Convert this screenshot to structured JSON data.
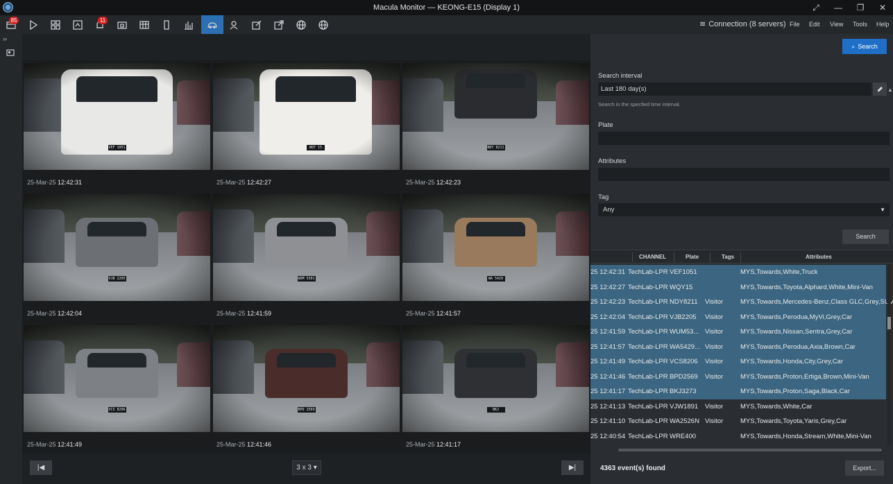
{
  "window": {
    "title": "Macula Monitor — KEONG-E15 (Display 1)",
    "controls": [
      "⤢",
      "—",
      "❐",
      "✕"
    ]
  },
  "toolbar": {
    "badge_events": "85",
    "badge_alarms": "11",
    "connection_label": "Connection (8 servers)",
    "menu": [
      "File",
      "Edit",
      "View",
      "Tools",
      "Help"
    ]
  },
  "grid": {
    "cells": [
      {
        "date": "25-Mar-25",
        "time": "12:42:31",
        "plate": "VEF 1051"
      },
      {
        "date": "25-Mar-25",
        "time": "12:42:27",
        "plate": "WQY 15"
      },
      {
        "date": "25-Mar-25",
        "time": "12:42:23",
        "plate": "NDY 8211"
      },
      {
        "date": "25-Mar-25",
        "time": "12:42:04",
        "plate": "VJB 2205"
      },
      {
        "date": "25-Mar-25",
        "time": "12:41:59",
        "plate": "WUM 5301"
      },
      {
        "date": "25-Mar-25",
        "time": "12:41:57",
        "plate": "WA 5429"
      },
      {
        "date": "25-Mar-25",
        "time": "12:41:49",
        "plate": "VCS 8206"
      },
      {
        "date": "25-Mar-25",
        "time": "12:41:46",
        "plate": "BPD 2569"
      },
      {
        "date": "25-Mar-25",
        "time": "12:41:17",
        "plate": "BKJ"
      }
    ],
    "layout_label": "3 x 3"
  },
  "panel": {
    "search_top_label": "Search",
    "interval_label": "Search interval",
    "interval_value": "Last 180 day(s)",
    "interval_hint": "Search in the specfied time interval.",
    "plate_label": "Plate",
    "plate_value": "",
    "attributes_label": "Attributes",
    "attributes_value": "",
    "tag_label": "Tag",
    "tag_value": "Any",
    "search_label": "Search"
  },
  "table": {
    "headers": [
      "CHANNEL",
      "Plate",
      "Tags",
      "Attributes"
    ],
    "rows": [
      {
        "time": "25 12:42:31",
        "channel": "TechLab-LPR",
        "plate": "VEF1051",
        "tag": "",
        "attrs": "MYS,Towards,White,Truck",
        "selected": true
      },
      {
        "time": "25 12:42:27",
        "channel": "TechLab-LPR",
        "plate": "WQY15",
        "tag": "",
        "attrs": "MYS,Towards,Toyota,Alphard,White,Mini-Van",
        "selected": true
      },
      {
        "time": "25 12:42:23",
        "channel": "TechLab-LPR",
        "plate": "NDY8211",
        "tag": "Visitor",
        "attrs": "MYS,Towards,Mercedes-Benz,Class GLC,Grey,SUV",
        "selected": true
      },
      {
        "time": "25 12:42:04",
        "channel": "TechLab-LPR",
        "plate": "VJB2205",
        "tag": "Visitor",
        "attrs": "MYS,Towards,Perodua,MyVi,Grey,Car",
        "selected": true
      },
      {
        "time": "25 12:41:59",
        "channel": "TechLab-LPR",
        "plate": "WUM53...",
        "tag": "Visitor",
        "attrs": "MYS,Towards,Nissan,Sentra,Grey,Car",
        "selected": true
      },
      {
        "time": "25 12:41:57",
        "channel": "TechLab-LPR",
        "plate": "WA5429...",
        "tag": "Visitor",
        "attrs": "MYS,Towards,Perodua,Axia,Brown,Car",
        "selected": true
      },
      {
        "time": "25 12:41:49",
        "channel": "TechLab-LPR",
        "plate": "VCS8206",
        "tag": "Visitor",
        "attrs": "MYS,Towards,Honda,City,Grey,Car",
        "selected": true
      },
      {
        "time": "25 12:41:46",
        "channel": "TechLab-LPR",
        "plate": "BPD2569",
        "tag": "Visitor",
        "attrs": "MYS,Towards,Proton,Ertiga,Brown,Mini-Van",
        "selected": true
      },
      {
        "time": "25 12:41:17",
        "channel": "TechLab-LPR",
        "plate": "BKJ3273",
        "tag": "",
        "attrs": "MYS,Towards,Proton,Saga,Black,Car",
        "selected": true
      },
      {
        "time": "25 12:41:13",
        "channel": "TechLab-LPR",
        "plate": "VJW1891",
        "tag": "Visitor",
        "attrs": "MYS,Towards,White,Car",
        "selected": false
      },
      {
        "time": "25 12:41:10",
        "channel": "TechLab-LPR",
        "plate": "WA2526N",
        "tag": "Visitor",
        "attrs": "MYS,Towards,Toyota,Yaris,Grey,Car",
        "selected": false
      },
      {
        "time": "25 12:40:54",
        "channel": "TechLab-LPR",
        "plate": "WRE400",
        "tag": "",
        "attrs": "MYS,Towards,Honda,Stream,White,Mini-Van",
        "selected": false
      }
    ]
  },
  "footer": {
    "events_found": "4363 event(s) found",
    "export_label": "Export..."
  },
  "colors": {
    "accent": "#2c6fb3",
    "selected_row": "#3b6580",
    "badge": "#d42020"
  }
}
